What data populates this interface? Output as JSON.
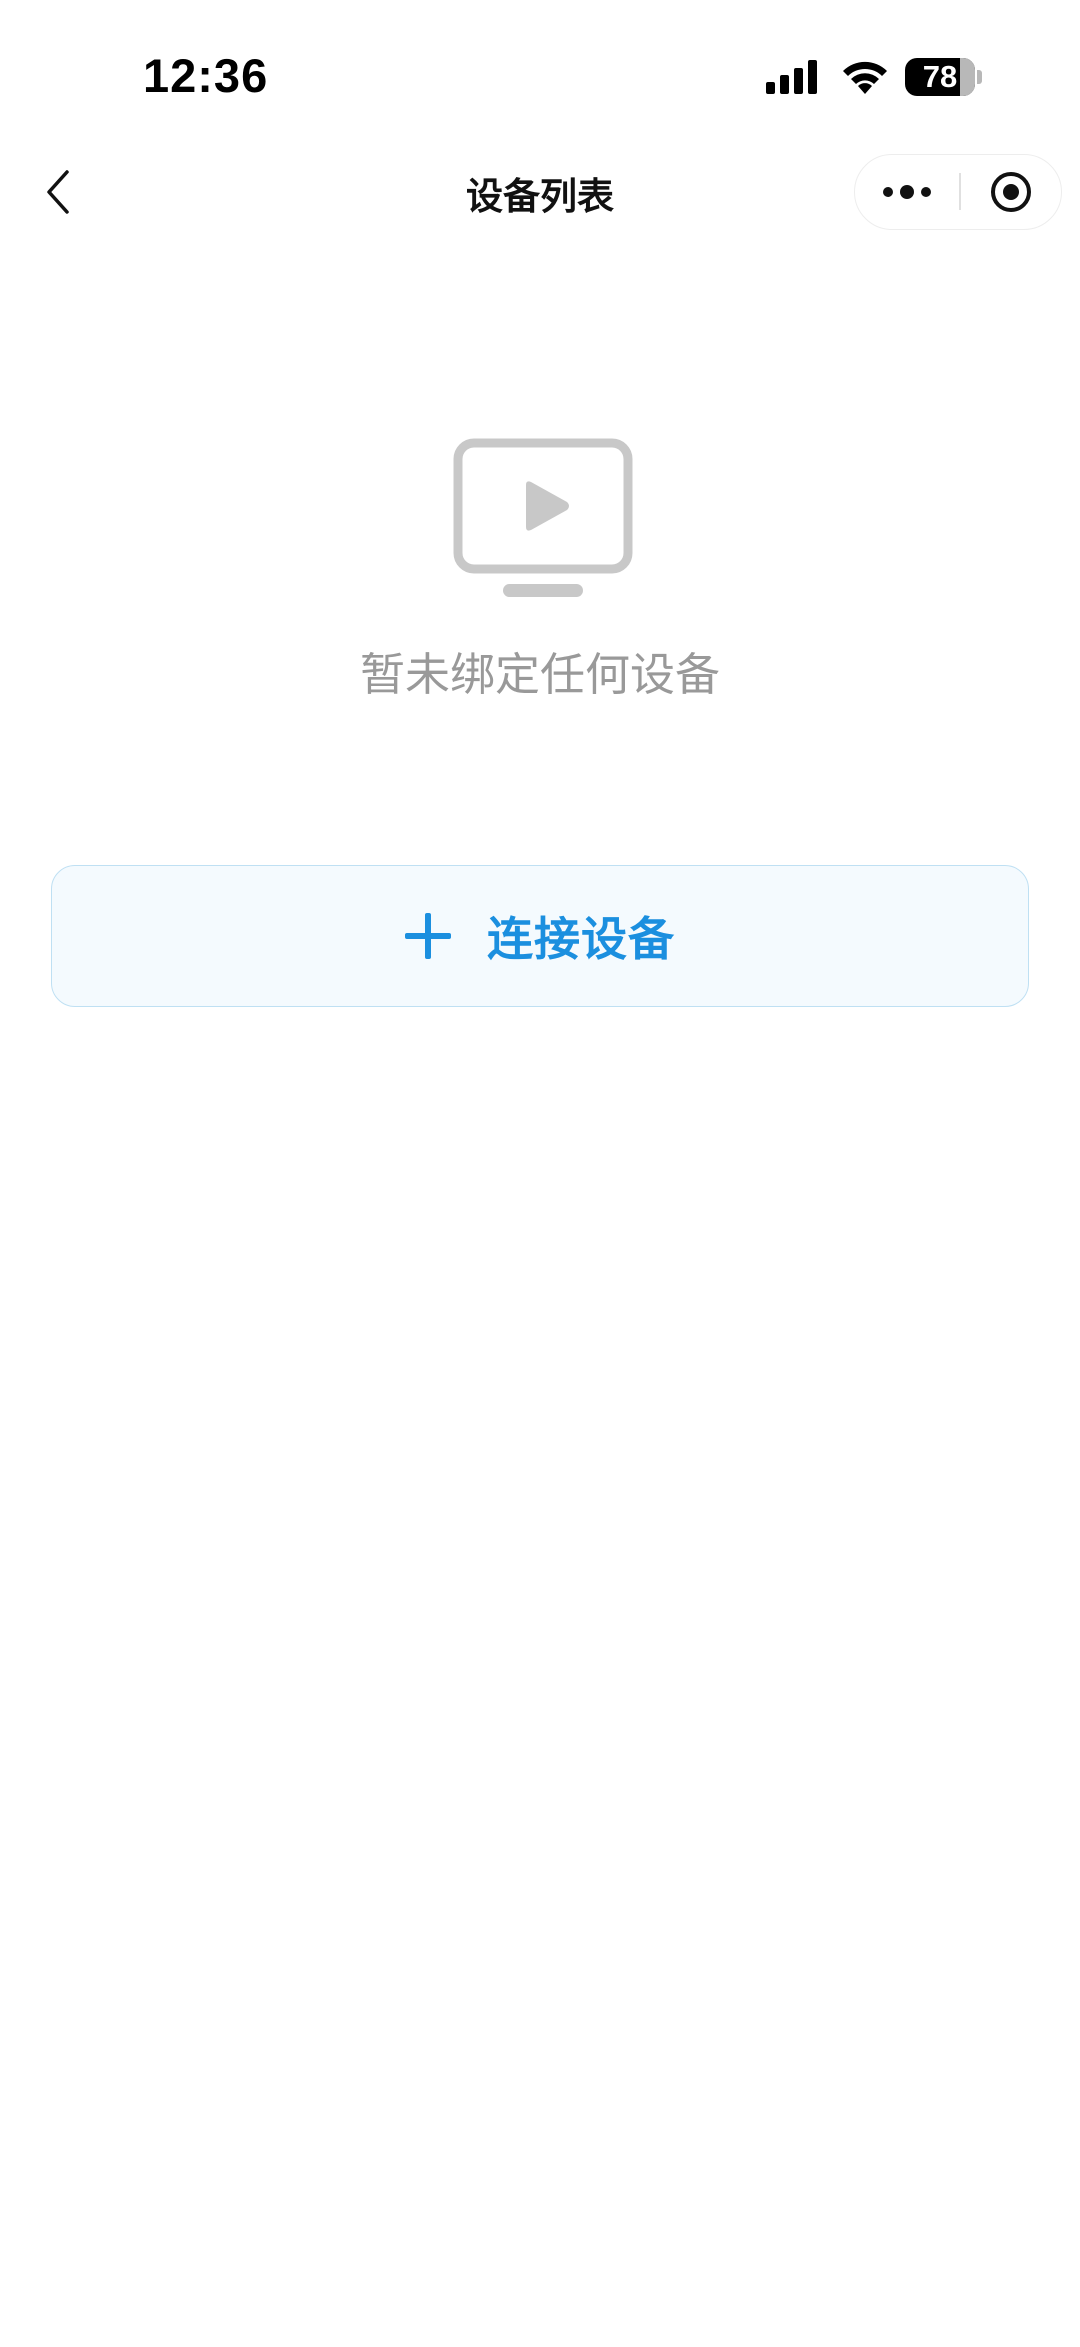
{
  "status_bar": {
    "time": "12:36",
    "battery_level": "78",
    "icons": [
      "signal-icon",
      "wifi-icon",
      "battery-icon"
    ]
  },
  "nav": {
    "title": "设备列表",
    "back_icon": "chevron-left-icon",
    "more_icon": "more-dots-icon",
    "close_icon": "target-close-icon"
  },
  "empty_state": {
    "icon": "tv-play-icon",
    "message": "暂未绑定任何设备"
  },
  "actions": {
    "connect_icon": "plus-icon",
    "connect_label": "连接设备"
  },
  "colors": {
    "accent": "#1b8fdf",
    "button_bg": "#f4fafe",
    "button_border": "#bfe0f3",
    "muted_text": "#999999",
    "icon_gray": "#c8c8c8"
  }
}
